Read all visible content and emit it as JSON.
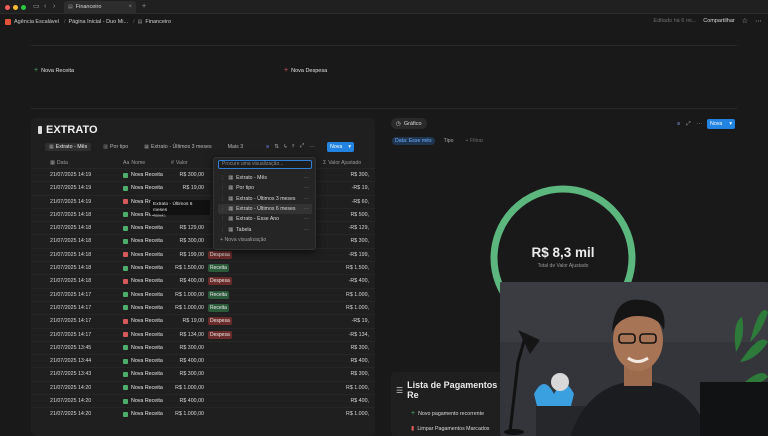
{
  "browser": {
    "tab_title": "Financeiro",
    "new_tab": "+"
  },
  "breadcrumbs": [
    {
      "label": "Agência Escalável",
      "color": "#e0533a"
    },
    {
      "label": "Página Inicial - Duo Mi...",
      "color": "#9a9a9a"
    },
    {
      "label": "Financeiro",
      "color": "#9a9a9a"
    }
  ],
  "topright": {
    "edited": "Editado há 6 mi...",
    "share": "Compartilhar"
  },
  "actions": {
    "nova_receita": "Nova Receita",
    "nova_despesa": "Nova Despesa"
  },
  "extrato": {
    "title": "EXTRATO",
    "views": [
      "Extrato - Mês",
      "Por tipo",
      "Extrato - Últimos 3 meses",
      "Mais 3"
    ],
    "new_button": "Nova",
    "columns": {
      "date": "Data",
      "name": "Nome",
      "value": "Valor",
      "adjusted": "Valor Ajustado"
    },
    "rows": [
      {
        "date": "21/07/2025 14:19",
        "name": "Nova Receita",
        "icon": "up",
        "value": "R$ 300,00",
        "type": "",
        "adjusted": "R$ 300,"
      },
      {
        "date": "21/07/2025 14:19",
        "name": "Nova Receita",
        "icon": "up",
        "value": "R$ 19,00",
        "type": "",
        "adjusted": "-R$ 19,"
      },
      {
        "date": "21/07/2025 14:19",
        "name": "Nova Re",
        "icon": "down",
        "value": "",
        "type": "",
        "adjusted": "-R$ 60,"
      },
      {
        "date": "21/07/2025 14:18",
        "name": "Nova Receita",
        "icon": "up",
        "value": "",
        "type": "",
        "adjusted": "R$ 500,"
      },
      {
        "date": "21/07/2025 14:18",
        "name": "Nova Receita",
        "icon": "up",
        "value": "R$ 129,00",
        "type": "",
        "adjusted": "-R$ 129,"
      },
      {
        "date": "21/07/2025 14:18",
        "name": "Nova Receita",
        "icon": "up",
        "value": "R$ 300,00",
        "type": "",
        "adjusted": "R$ 300,"
      },
      {
        "date": "21/07/2025 14:18",
        "name": "Nova Receita",
        "icon": "down",
        "value": "R$ 199,00",
        "type": "Despesa",
        "adjusted": "-R$ 199,"
      },
      {
        "date": "21/07/2025 14:18",
        "name": "Nova Receita",
        "icon": "up",
        "value": "R$ 1.500,00",
        "type": "Receita",
        "adjusted": "R$ 1.500,"
      },
      {
        "date": "21/07/2025 14:18",
        "name": "Nova Receita",
        "icon": "down",
        "value": "R$ 400,00",
        "type": "Despesa",
        "adjusted": "-R$ 400,"
      },
      {
        "date": "21/07/2025 14:17",
        "name": "Nova Receita",
        "icon": "up",
        "value": "R$ 1.000,00",
        "type": "Receita",
        "adjusted": "R$ 1.000,"
      },
      {
        "date": "21/07/2025 14:17",
        "name": "Nova Receita",
        "icon": "up",
        "value": "R$ 1.000,00",
        "type": "Receita",
        "adjusted": "R$ 1.000,"
      },
      {
        "date": "21/07/2025 14:17",
        "name": "Nova Receita",
        "icon": "down",
        "value": "R$ 19,00",
        "type": "Despesa",
        "adjusted": "-R$ 19,"
      },
      {
        "date": "21/07/2025 14:17",
        "name": "Nova Receita",
        "icon": "down",
        "value": "R$ 134,00",
        "type": "Despesa",
        "adjusted": "-R$ 134,"
      },
      {
        "date": "21/07/2025 13:45",
        "name": "Nova Receita",
        "icon": "up",
        "value": "R$ 300,00",
        "type": "",
        "adjusted": "R$ 300,"
      },
      {
        "date": "21/07/2025 13:44",
        "name": "Nova Receita",
        "icon": "up",
        "value": "R$ 400,00",
        "type": "",
        "adjusted": "R$ 400,"
      },
      {
        "date": "21/07/2025 13:43",
        "name": "Nova Receita",
        "icon": "up",
        "value": "R$ 300,00",
        "type": "",
        "adjusted": "R$ 300,"
      },
      {
        "date": "21/07/2025 14:20",
        "name": "Nova Receita",
        "icon": "up",
        "value": "R$ 1.000,00",
        "type": "",
        "adjusted": "R$ 1.000,"
      },
      {
        "date": "21/07/2025 14:20",
        "name": "Nova Receita",
        "icon": "up",
        "value": "R$ 400,00",
        "type": "",
        "adjusted": "R$ 400,"
      },
      {
        "date": "21/07/2025 14:20",
        "name": "Nova Receita",
        "icon": "up",
        "value": "R$ 1.000,00",
        "type": "",
        "adjusted": "R$ 1.000,"
      }
    ]
  },
  "view_dropdown": {
    "search_placeholder": "Procure uma visualização...",
    "items": [
      "Extrato - Mês",
      "Por tipo",
      "Extrato - Últimos 3 meses",
      "Extrato - Últimos 6 meses",
      "Extrato - Esse Ano",
      "Tabela"
    ],
    "new_view": "Nova visualização",
    "tooltip": "Extrato - Últimos 6 meses",
    "tooltip_sub": "Tabela"
  },
  "grafico": {
    "label": "Gráfico",
    "new_button": "Nova",
    "filters": [
      "Data: Esse mês",
      "Tipo",
      "+ Filtrar"
    ],
    "total_value": "R$ 8,3 mil",
    "total_label": "Total de Valor Ajustado",
    "ring_fraction": 1.0,
    "ring_color": "#5bb77d"
  },
  "pagamentos": {
    "title": "Lista de Pagamentos Re",
    "items": [
      "Novo pagamento recorrente",
      "Limpar Pagamentos Marcados"
    ]
  },
  "colors": {
    "receita": "#2b5a3a",
    "despesa": "#6b2b2b",
    "accent": "#2383e2"
  }
}
